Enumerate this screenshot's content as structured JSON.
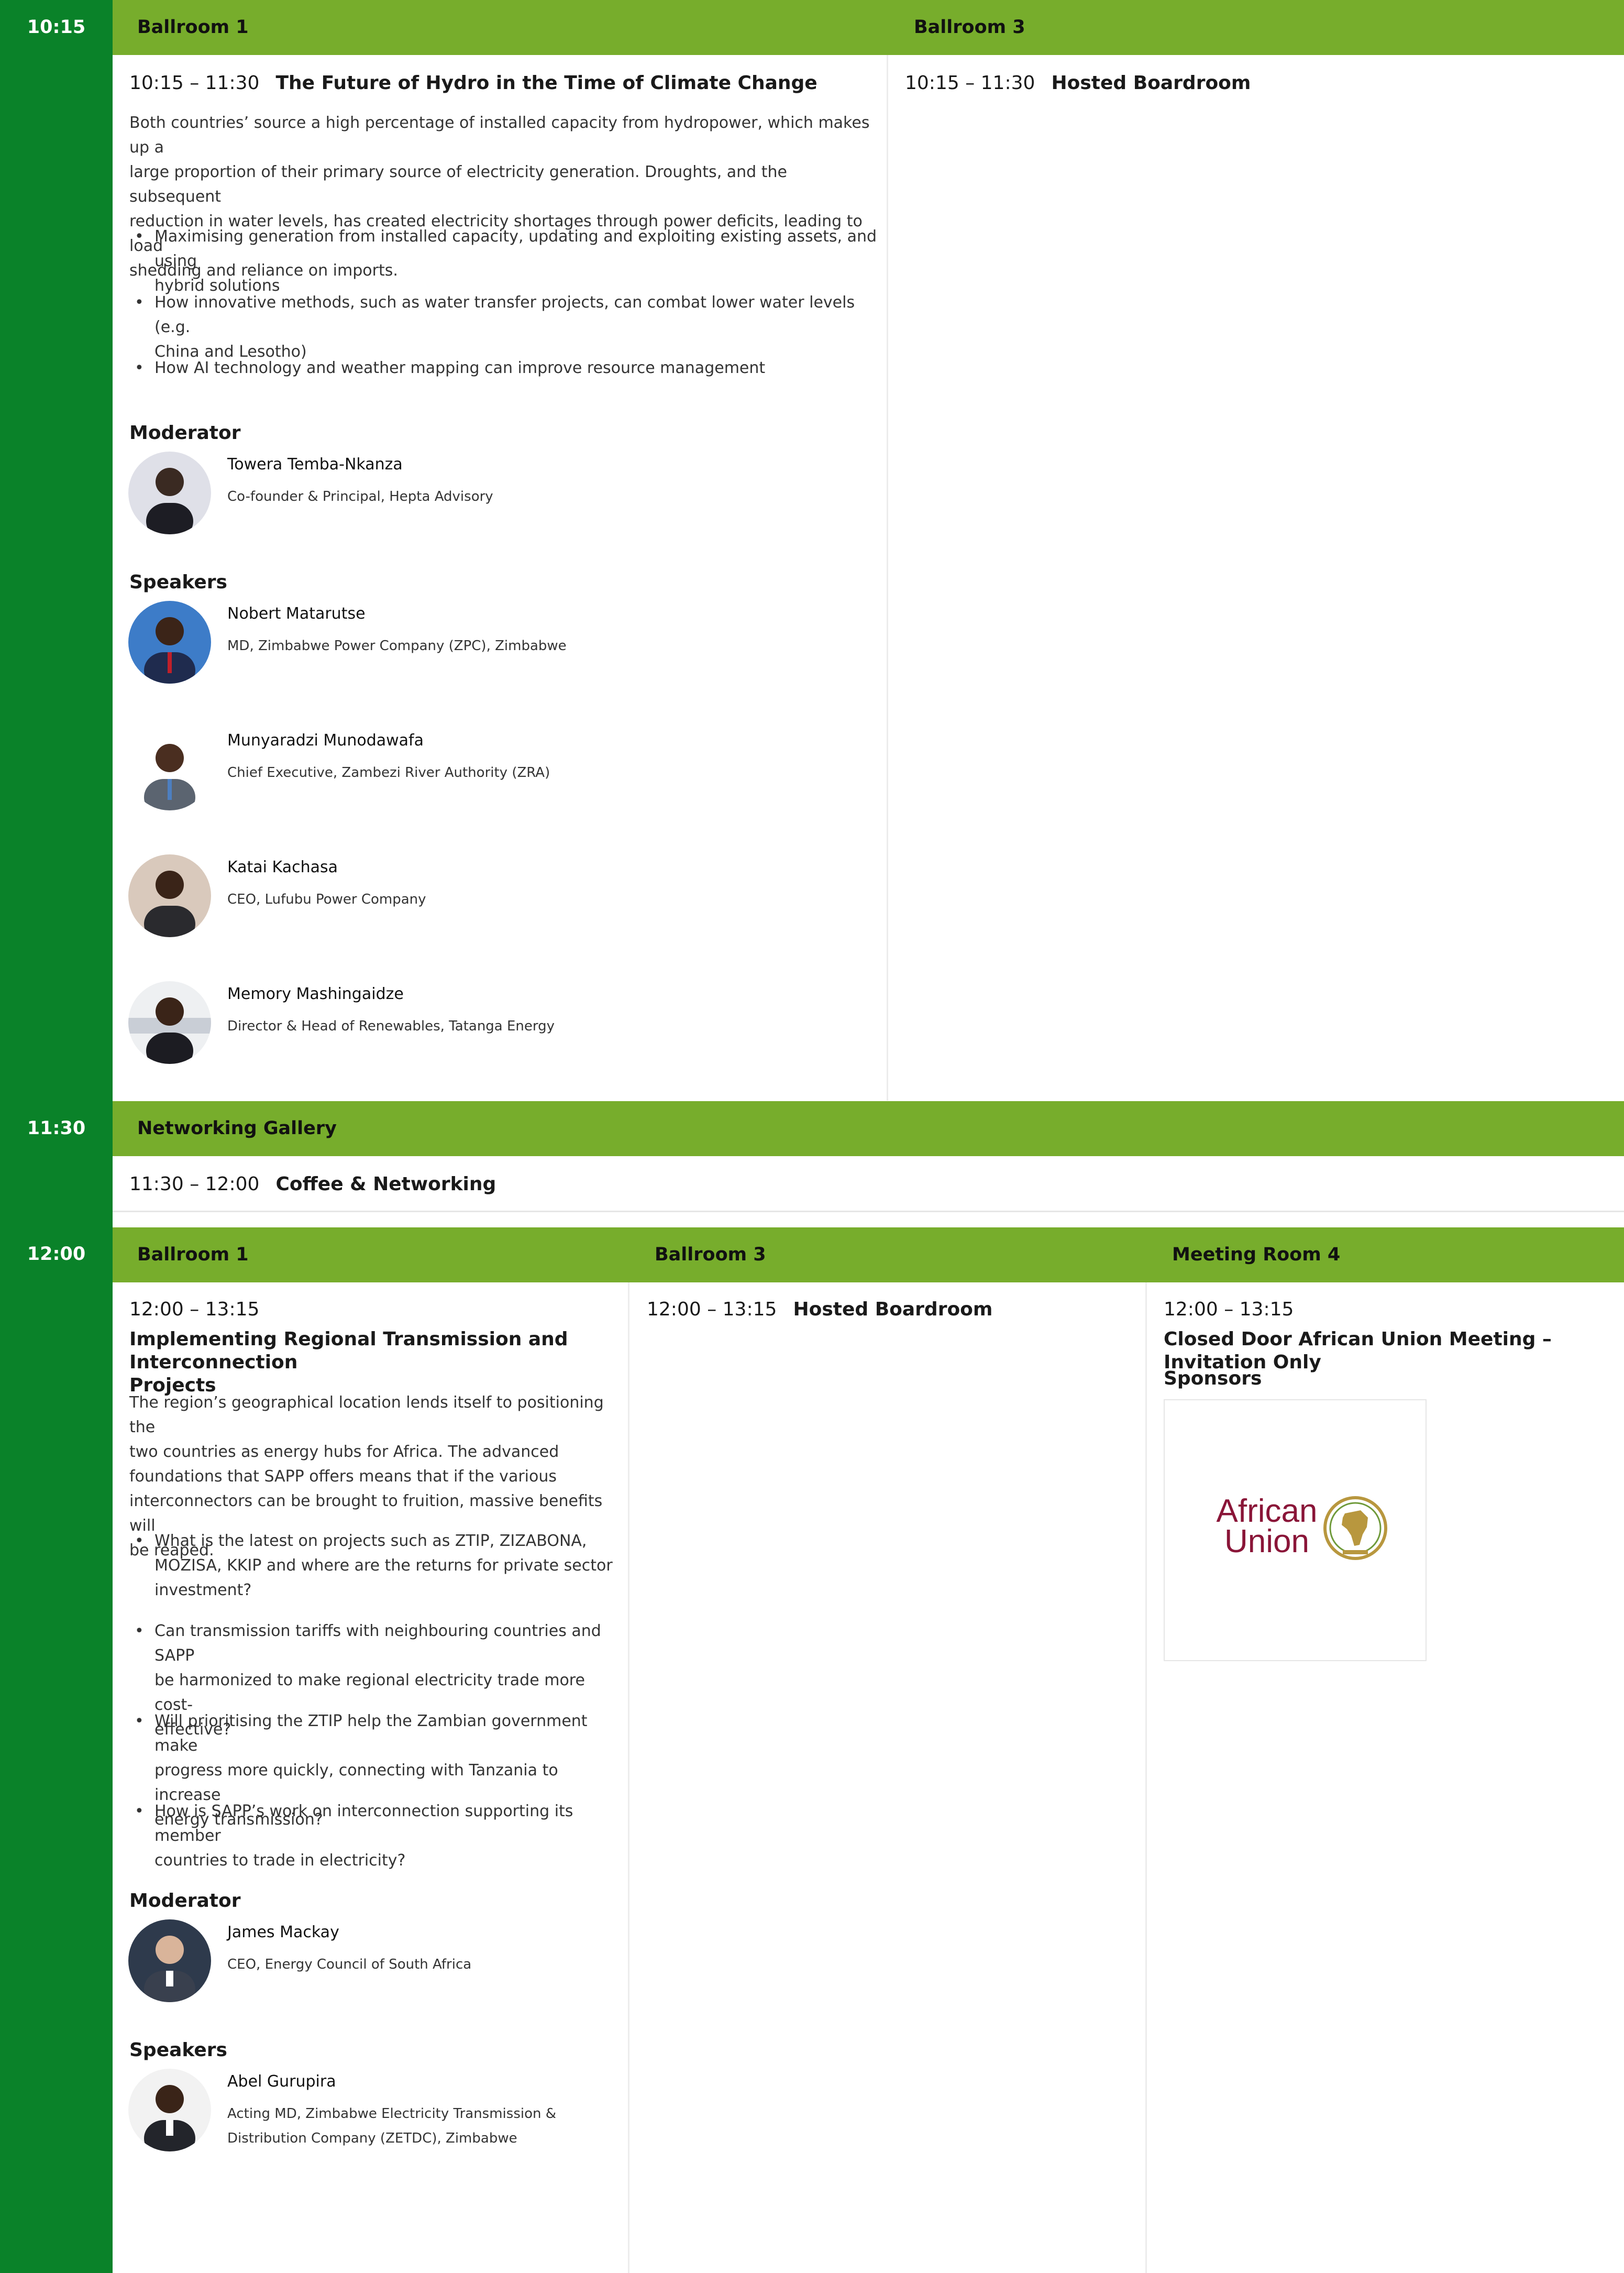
{
  "sections": {
    "s1": {
      "time": "10:15",
      "rooms": [
        "Ballroom 1",
        "Ballroom 3"
      ],
      "session1": {
        "time": "10:15 – 11:30",
        "title": "The Future of Hydro in the Time of Climate Change",
        "description": [
          "Both countries’ source a high percentage of installed capacity from hydropower, which makes up a",
          "large proportion of their primary source of electricity generation. Droughts, and the subsequent",
          "reduction in water levels, has created electricity shortages through power deficits, leading to load",
          "shedding and reliance on imports."
        ],
        "bullets": [
          [
            "Maximising generation from installed capacity, updating and exploiting existing assets, and using",
            "hybrid solutions"
          ],
          [
            "How innovative methods, such as water transfer projects, can combat lower water levels (e.g.",
            "China and Lesotho)"
          ],
          [
            "How AI technology and weather mapping can improve resource management"
          ]
        ],
        "moderator_label": "Moderator",
        "moderator": {
          "name": "Towera Temba-Nkanza",
          "title": "Co-founder & Principal, Hepta Advisory"
        },
        "speakers_label": "Speakers",
        "speakers": [
          {
            "name": "Nobert Matarutse",
            "title": "MD, Zimbabwe Power Company (ZPC), Zimbabwe"
          },
          {
            "name": "Munyaradzi Munodawafa",
            "title": "Chief Executive, Zambezi River Authority (ZRA)"
          },
          {
            "name": "Katai Kachasa",
            "title": "CEO, Lufubu Power Company"
          },
          {
            "name": "Memory Mashingaidze",
            "title": "Director & Head of Renewables, Tatanga Energy"
          }
        ]
      },
      "session2": {
        "time": "10:15 – 11:30",
        "title": "Hosted Boardroom"
      }
    },
    "s2": {
      "time": "11:30",
      "room": "Networking Gallery",
      "session": {
        "time": "11:30 – 12:00",
        "title": "Coffee & Networking"
      }
    },
    "s3": {
      "time": "12:00",
      "rooms": [
        "Ballroom 1",
        "Ballroom 3",
        "Meeting Room 4"
      ],
      "session1": {
        "time": "12:00 – 13:15",
        "title": [
          "Implementing Regional Transmission and Interconnection",
          "Projects"
        ],
        "description": [
          "The region’s geographical location lends itself to positioning the",
          "two countries as energy hubs for Africa. The advanced",
          "foundations that SAPP offers means that if the various",
          "interconnectors can be brought to fruition, massive benefits will",
          "be reaped."
        ],
        "bullets": [
          [
            "What is the latest on projects such as ZTIP, ZIZABONA,",
            "MOZISA, KKIP and where are the returns for private sector",
            "investment?"
          ],
          [
            "Can transmission tariffs with neighbouring countries and SAPP",
            "be harmonized to make regional electricity trade more cost-",
            "effective?"
          ],
          [
            "Will prioritising the ZTIP help the Zambian government make",
            "progress more quickly, connecting with Tanzania to increase",
            "energy transmission?"
          ],
          [
            "How is SAPP’s work on interconnection supporting its member",
            "countries to trade in electricity?"
          ]
        ],
        "moderator_label": "Moderator",
        "moderator": {
          "name": "James Mackay",
          "title": "CEO, Energy Council of South Africa"
        },
        "speakers_label": "Speakers",
        "speakers": [
          {
            "name": "Abel Gurupira",
            "title": [
              "Acting MD, Zimbabwe Electricity Transmission &",
              "Distribution Company (ZETDC), Zimbabwe"
            ]
          }
        ]
      },
      "session2": {
        "time": "12:00 – 13:15",
        "title": "Hosted Boardroom"
      },
      "session3": {
        "time": "12:00 – 13:15",
        "title": "Closed Door African Union Meeting – Invitation Only",
        "sponsors_label": "Sponsors",
        "logo_line1": "African",
        "logo_line2": "Union"
      }
    }
  },
  "colors": {
    "rail": "#0a8229",
    "header": "#77ad2c",
    "logo_text": "#8a1538",
    "logo_gold": "#b8973e"
  }
}
